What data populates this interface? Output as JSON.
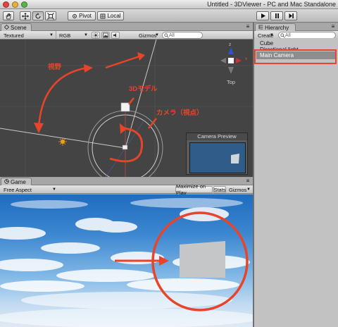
{
  "window": {
    "title": "Untitled - 3DViewer - PC and Mac Standalone"
  },
  "toolbar": {
    "pivot_label": "Pivot",
    "local_label": "Local",
    "tools": [
      "hand-tool",
      "move-tool",
      "rotate-tool",
      "scale-tool"
    ],
    "playback": [
      "play",
      "pause",
      "step"
    ]
  },
  "scene": {
    "tab_label": "Scene",
    "render_mode": "Textured",
    "color_mode": "RGB",
    "gizmos_label": "Gizmos",
    "search_placeholder": "All",
    "gizmo_axes": {
      "y": "y",
      "z": "z",
      "x": "x"
    },
    "view_label": "Top",
    "annotations": {
      "fov": "視野",
      "model": "3Dモデル",
      "camera": "カメラ（視点）"
    },
    "camera_preview_title": "Camera Preview"
  },
  "game": {
    "tab_label": "Game",
    "aspect": "Free Aspect",
    "maximize_label": "Maximize on Play",
    "stats_label": "Stats",
    "gizmos_label": "Gizmos"
  },
  "hierarchy": {
    "tab_label": "Hierarchy",
    "create_label": "Create",
    "search_placeholder": "All",
    "items": [
      {
        "label": "Cube",
        "selected": false
      },
      {
        "label": "Directional light",
        "selected": false
      },
      {
        "label": "Main Camera",
        "selected": true
      }
    ]
  },
  "colors": {
    "annotation": "#e8442a",
    "scene_bg": "#444444",
    "selection": "#8d8d8d"
  }
}
